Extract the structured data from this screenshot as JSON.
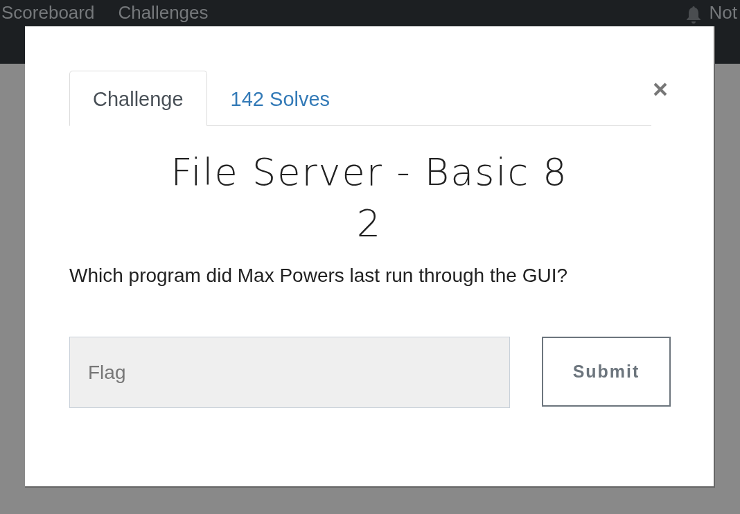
{
  "navbar": {
    "links": [
      "Scoreboard",
      "Challenges"
    ],
    "notifications_label": "Not"
  },
  "modal": {
    "tabs": [
      {
        "label": "Challenge",
        "selected": true
      },
      {
        "label": "142 Solves",
        "selected": false
      }
    ],
    "title": "File Server - Basic 8 2",
    "description": "Which program did Max Powers last run through the GUI?",
    "flag_field": {
      "placeholder": "Flag"
    },
    "submit_button": "Submit"
  }
}
